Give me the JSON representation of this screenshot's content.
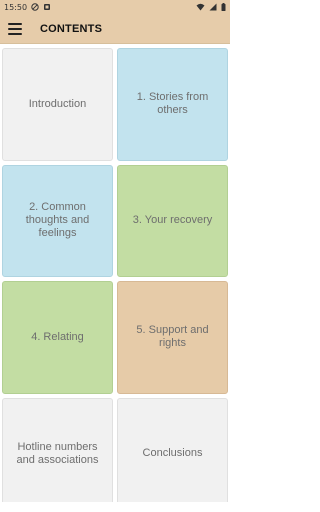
{
  "status_bar": {
    "time": "15:50",
    "icons": [
      "do-not-disturb-icon",
      "notification-icon",
      "wifi-icon",
      "signal-icon",
      "battery-icon"
    ]
  },
  "app_bar": {
    "menu_icon": "menu-icon",
    "title": "CONTENTS",
    "background": "#e6ccaa"
  },
  "tiles": [
    {
      "label": "Introduction",
      "color": "#f1f1f1"
    },
    {
      "label": "1. Stories from others",
      "color": "#c2e3ee"
    },
    {
      "label": "2. Common thoughts and feelings",
      "color": "#c2e3ee"
    },
    {
      "label": "3. Your recovery",
      "color": "#c3dda3"
    },
    {
      "label": "4. Relating",
      "color": "#c3dda3"
    },
    {
      "label": "5. Support and rights",
      "color": "#e6cba8"
    },
    {
      "label": "Hotline numbers and associations",
      "color": "#f1f1f1"
    },
    {
      "label": "Conclusions",
      "color": "#f1f1f1"
    }
  ]
}
